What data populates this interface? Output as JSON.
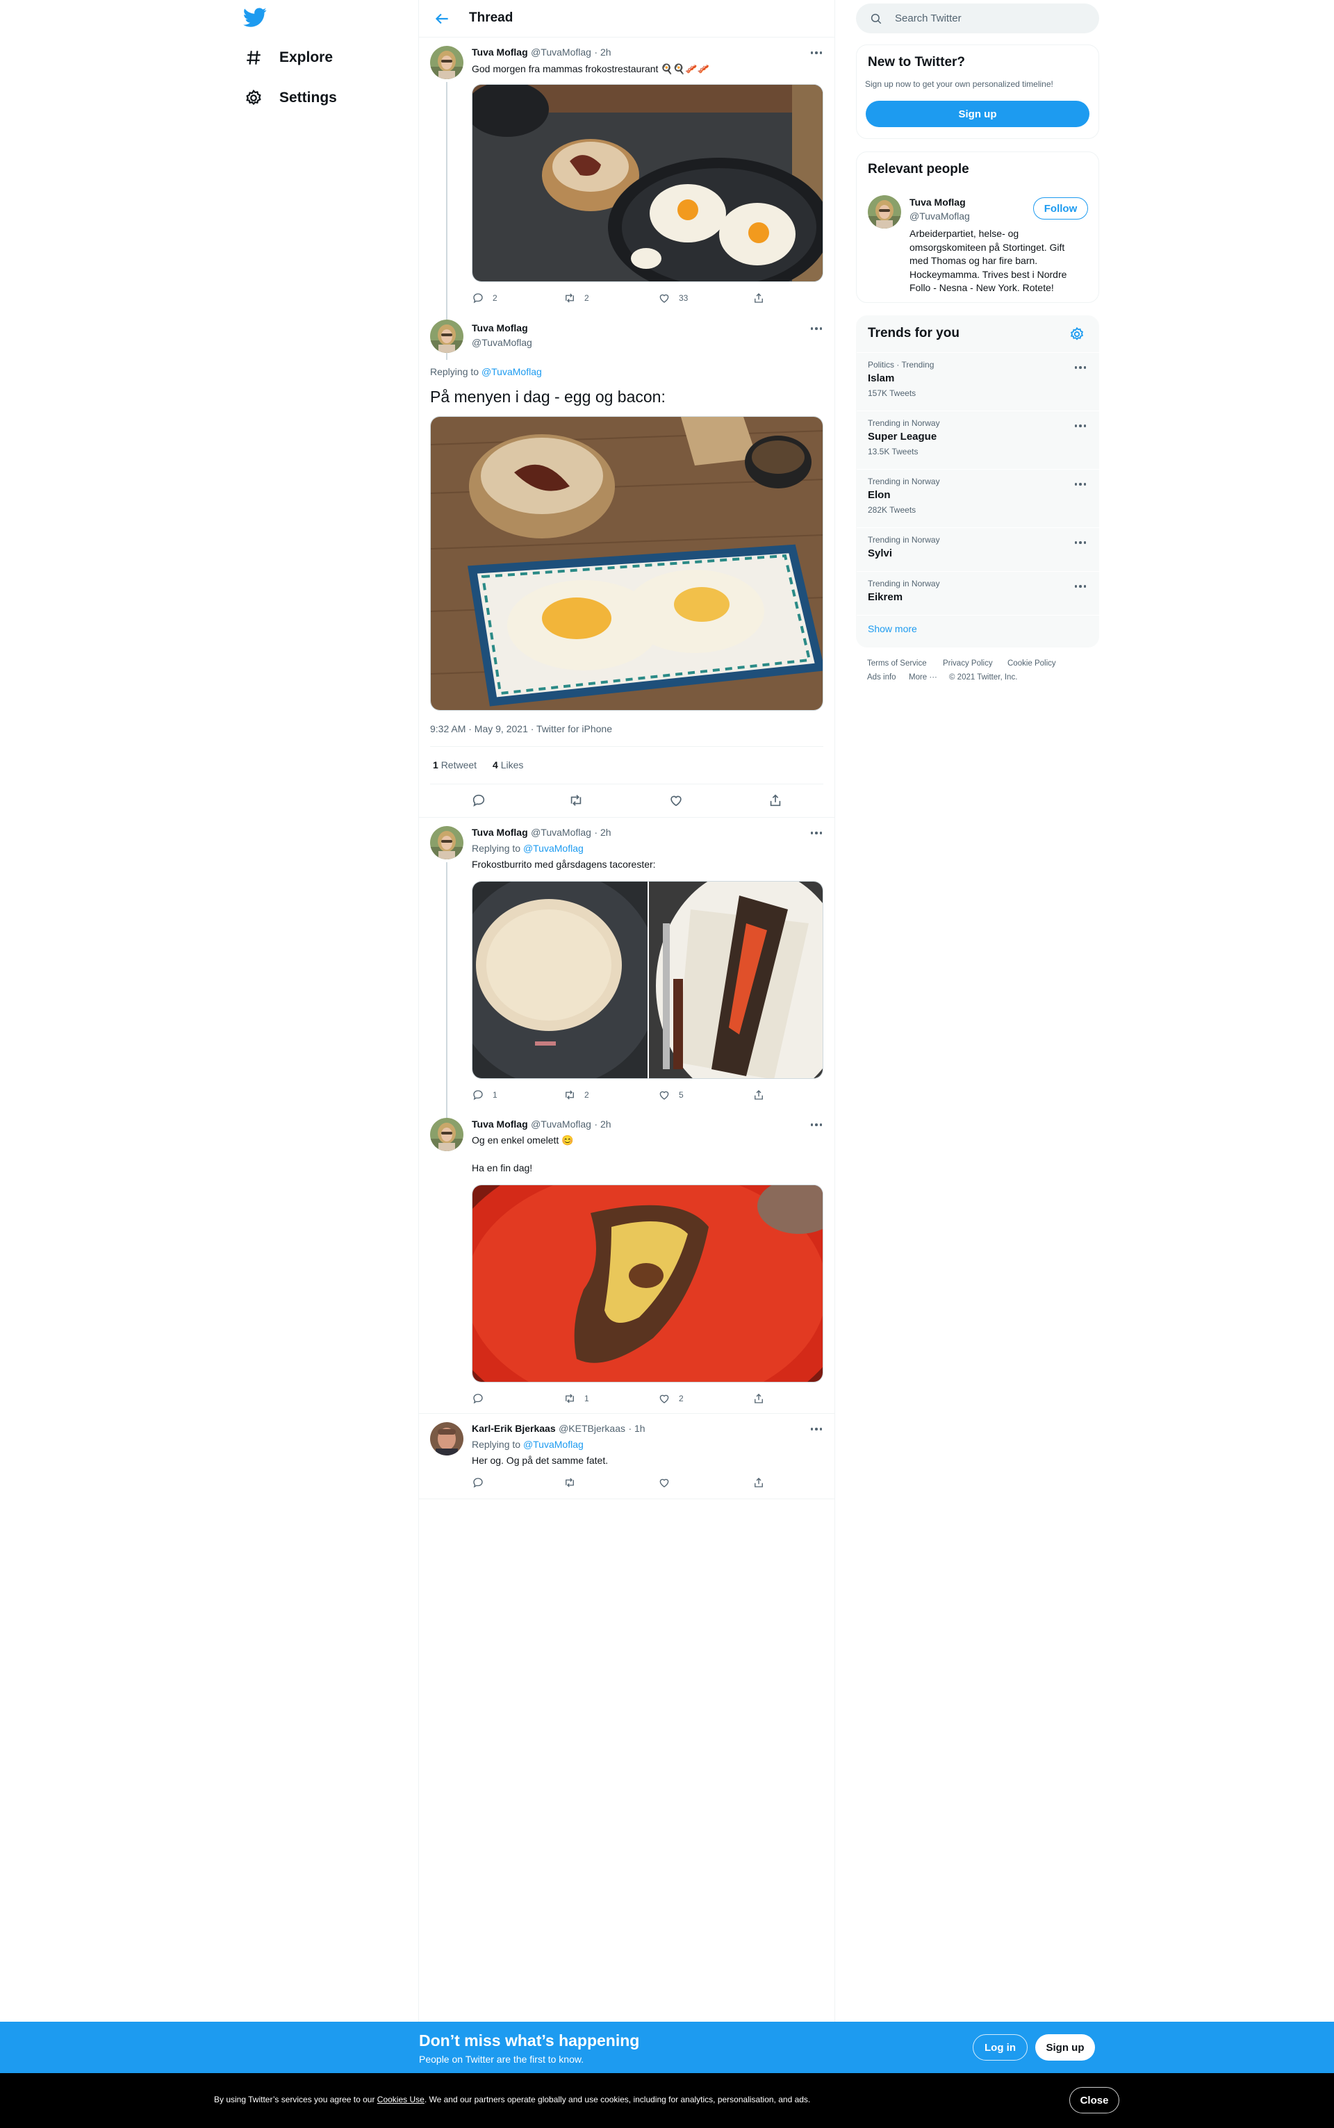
{
  "nav": {
    "logo": "twitter-bird-icon",
    "items": [
      {
        "label": "Explore",
        "icon": "hashtag-icon"
      },
      {
        "label": "Settings",
        "icon": "gear-icon"
      }
    ]
  },
  "header": {
    "title": "Thread",
    "back_icon": "back-arrow-icon"
  },
  "tweets": {
    "t1": {
      "name": "Tuva Moflag",
      "handle": "@TuvaMoflag",
      "time": "· 2h",
      "text": "God morgen fra mammas frokostrestaurant 🍳🍳🥓🥓",
      "image": "Frying pan with two eggs and a bowl of bacon",
      "replies": "2",
      "retweets": "2",
      "likes": "33"
    },
    "focus": {
      "name": "Tuva Moflag",
      "handle": "@TuvaMoflag",
      "replying_prefix": "Replying to",
      "replying_to": "@TuvaMoflag",
      "text": "På menyen i dag - egg og bacon:",
      "image": "Plate of fried eggs with a bowl of bacon on a wooden table",
      "timestamp": "9:32 AM · May 9, 2021 · Twitter for iPhone",
      "retweet_count": "1",
      "retweet_label": "Retweet",
      "like_count": "4",
      "like_label": "Likes"
    },
    "t3": {
      "name": "Tuva Moflag",
      "handle": "@TuvaMoflag",
      "time": "· 2h",
      "replying_prefix": "Replying to",
      "replying_to": "@TuvaMoflag",
      "text": "Frokostburrito med gårsdagens tacorester:",
      "replies": "1",
      "retweets": "2",
      "likes": "5"
    },
    "t4": {
      "name": "Tuva Moflag",
      "handle": "@TuvaMoflag",
      "time": "· 2h",
      "text1": "Og en enkel omelett 😊",
      "text2": "Ha en fin dag!",
      "replies": "",
      "retweets": "1",
      "likes": "2"
    },
    "t5": {
      "name": "Karl-Erik Bjerkaas",
      "handle": "@KETBjerkaas",
      "time": "· 1h",
      "replying_prefix": "Replying to",
      "replying_to": "@TuvaMoflag",
      "text": "Her og. Og på det samme fatet.",
      "replies": "",
      "retweets": "",
      "likes": ""
    }
  },
  "sidebar": {
    "search_placeholder": "Search Twitter",
    "new": {
      "title": "New to Twitter?",
      "sub": "Sign up now to get your own personalized timeline!",
      "button": "Sign up"
    },
    "relevant": {
      "title": "Relevant people",
      "name": "Tuva Moflag",
      "handle": "@TuvaMoflag",
      "follow": "Follow",
      "bio1": "Arbeiderpartiet, helse- og",
      "bio2": "omsorgskomiteen på Stortinget. Gift",
      "bio3": "med Thomas og har fire barn.",
      "bio4": "Hockeymamma. Trives best i Nordre",
      "bio5": "Follo - Nesna - New York. Rotete!"
    },
    "trends": {
      "title": "Trends for you",
      "items": [
        {
          "context": "Politics · Trending",
          "name": "Islam",
          "count": "157K Tweets"
        },
        {
          "context": "Trending in Norway",
          "name": "Super League",
          "count": "13.5K Tweets"
        },
        {
          "context": "Trending in Norway",
          "name": "Elon",
          "count": "282K Tweets"
        },
        {
          "context": "Trending in Norway",
          "name": "Sylvi",
          "count": ""
        },
        {
          "context": "Trending in Norway",
          "name": "Eikrem",
          "count": ""
        }
      ],
      "show_more": "Show more"
    },
    "footer": {
      "terms": "Terms of Service",
      "privacy": "Privacy Policy",
      "cookie": "Cookie Policy",
      "ads": "Ads info",
      "more": "More ···",
      "copyright": "© 2021 Twitter, Inc."
    }
  },
  "banner": {
    "title": "Don’t miss what’s happening",
    "sub": "People on Twitter are the first to know.",
    "login": "Log in",
    "signup": "Sign up"
  },
  "cookie": {
    "pre": "By using Twitter’s services you agree to our ",
    "link": "Cookies Use",
    "post": ". We and our partners operate globally and use cookies, including for analytics, personalisation, and ads.",
    "close": "Close"
  },
  "colors": {
    "accent": "#1d9bf0",
    "text": "#0f1419",
    "muted": "#536471"
  }
}
